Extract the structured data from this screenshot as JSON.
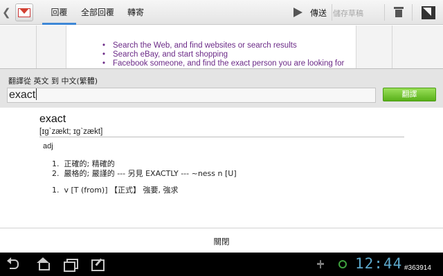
{
  "actionbar": {
    "tabs": [
      {
        "label": "回覆",
        "active": true
      },
      {
        "label": "全部回覆",
        "active": false
      },
      {
        "label": "轉寄",
        "active": false
      }
    ],
    "send_label": "傳送",
    "save_draft_label": "儲存草稿"
  },
  "compose": {
    "bullets": [
      "Search the Web, and find websites or search results",
      "Search eBay, and start shopping",
      "Facebook someone, and find the exact person you are looking for"
    ]
  },
  "dialog": {
    "direction_label": "翻譯從 英文 到 中文(繁體)",
    "input_value": "exact",
    "translate_button": "翻譯",
    "headword": "exact",
    "phonetic": "[ɪgˋzækt; ɪgˋzækt]",
    "part_of_speech": "adj",
    "definitions": [
      {
        "num": "1.",
        "text": "正確的; 精確的"
      },
      {
        "num": "2.",
        "text": "嚴格的; 嚴謹的 --- 另見 EXACTLY --- ~ness n [U]"
      }
    ],
    "verb_definitions": [
      {
        "num": "1.",
        "text": "v [T (from)] 【正式】 強要, 強求"
      }
    ],
    "close_button": "關閉"
  },
  "status": {
    "clock": "12:44",
    "watermark": "#363914"
  },
  "colors": {
    "tab_accent": "#3d87d6",
    "link_text": "#6b2a87",
    "translate_button": "#58b019",
    "clock": "#5da9cc"
  }
}
